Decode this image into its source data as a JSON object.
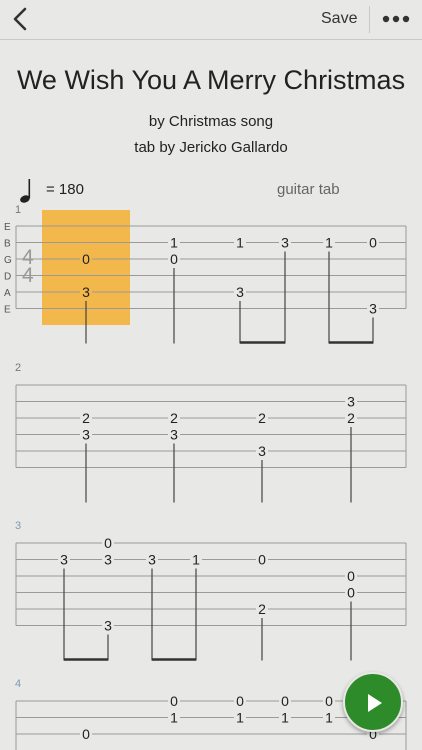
{
  "nav": {
    "save_label": "Save",
    "back_icon": "chevron-left-icon",
    "more_icon": "more-dots-icon"
  },
  "song": {
    "title": "We Wish You A Merry Christmas",
    "by": "by Christmas song",
    "tab_by": "tab by Jericko Gallardo",
    "tempo": "= 180",
    "tab_type": "guitar tab",
    "time_signature": [
      "4",
      "4"
    ],
    "string_names": [
      "E",
      "B",
      "G",
      "D",
      "A",
      "E"
    ]
  },
  "colors": {
    "highlight": "#f2b84b",
    "play_button": "#2e8b2a",
    "measure_number_blue": "#7b9bb5"
  },
  "measures": [
    {
      "number": "1",
      "notes": [
        {
          "beat": 0,
          "string": 2,
          "fret": "0"
        },
        {
          "beat": 0,
          "string": 4,
          "fret": "3"
        },
        {
          "beat": 1,
          "string": 1,
          "fret": "1"
        },
        {
          "beat": 1,
          "string": 2,
          "fret": "0"
        },
        {
          "beat": 2,
          "string": 1,
          "fret": "1"
        },
        {
          "beat": 2,
          "string": 4,
          "fret": "3"
        },
        {
          "beat": 3,
          "string": 1,
          "fret": "3"
        },
        {
          "beat": 4,
          "string": 1,
          "fret": "1"
        },
        {
          "beat": 5,
          "string": 1,
          "fret": "0"
        },
        {
          "beat": 5,
          "string": 5,
          "fret": "3"
        }
      ],
      "stems": [
        0,
        1,
        2,
        3,
        4,
        5
      ],
      "beams": [
        [
          2,
          3
        ],
        [
          4,
          5
        ]
      ],
      "highlight_beat": 0
    },
    {
      "number": "2",
      "notes": [
        {
          "beat": 0,
          "string": 2,
          "fret": "2"
        },
        {
          "beat": 0,
          "string": 3,
          "fret": "3"
        },
        {
          "beat": 1,
          "string": 2,
          "fret": "2"
        },
        {
          "beat": 1,
          "string": 3,
          "fret": "3"
        },
        {
          "beat": 2,
          "string": 2,
          "fret": "2"
        },
        {
          "beat": 2,
          "string": 4,
          "fret": "3"
        },
        {
          "beat": 3,
          "string": 1,
          "fret": "3"
        },
        {
          "beat": 3,
          "string": 2,
          "fret": "2"
        }
      ],
      "stems": [
        0,
        1,
        2,
        3
      ],
      "beams": []
    },
    {
      "number": "3",
      "notes": [
        {
          "beat": 0,
          "string": 1,
          "fret": "3"
        },
        {
          "beat": 1,
          "string": 0,
          "fret": "0"
        },
        {
          "beat": 1,
          "string": 1,
          "fret": "3"
        },
        {
          "beat": 1,
          "string": 5,
          "fret": "3"
        },
        {
          "beat": 2,
          "string": 1,
          "fret": "3"
        },
        {
          "beat": 3,
          "string": 1,
          "fret": "1"
        },
        {
          "beat": 4,
          "string": 1,
          "fret": "0"
        },
        {
          "beat": 4,
          "string": 4,
          "fret": "2"
        },
        {
          "beat": 5,
          "string": 2,
          "fret": "0"
        },
        {
          "beat": 5,
          "string": 3,
          "fret": "0"
        }
      ],
      "stems": [
        0,
        1,
        2,
        3,
        4,
        5
      ],
      "beams": [
        [
          0,
          1
        ],
        [
          2,
          3
        ]
      ]
    },
    {
      "number": "4",
      "notes": [
        {
          "beat": 0,
          "string": 2,
          "fret": "0"
        },
        {
          "beat": 1,
          "string": 0,
          "fret": "0"
        },
        {
          "beat": 1,
          "string": 1,
          "fret": "1"
        },
        {
          "beat": 2,
          "string": 0,
          "fret": "0"
        },
        {
          "beat": 2,
          "string": 1,
          "fret": "1"
        },
        {
          "beat": 3,
          "string": 0,
          "fret": "0"
        },
        {
          "beat": 3,
          "string": 1,
          "fret": "1"
        },
        {
          "beat": 4,
          "string": 0,
          "fret": "0"
        },
        {
          "beat": 4,
          "string": 1,
          "fret": "1"
        },
        {
          "beat": 5,
          "string": 2,
          "fret": "0"
        }
      ],
      "stems": [],
      "beams": []
    }
  ]
}
